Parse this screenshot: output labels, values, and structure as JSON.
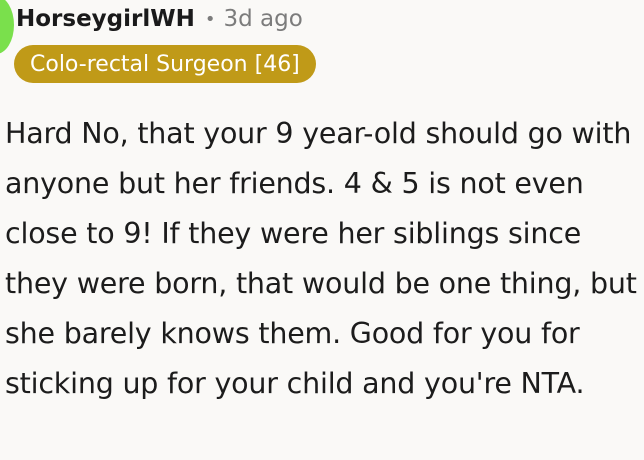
{
  "comment": {
    "author": {
      "username": "HorseygirlWH",
      "flair": "Colo-rectal Surgeon [46]",
      "avatar_color": "#7ae04c"
    },
    "separator": "•",
    "timestamp": "3d ago",
    "body": "Hard No, that your 9 year-old should go with anyone but her friends. 4 & 5 is not even close to 9! If they were her siblings since they were born, that would be one thing, but she barely knows them. Good for you for sticking up for your child and you're NTA."
  },
  "colors": {
    "background": "#faf9f7",
    "flair_background": "#c09a18",
    "meta_text": "#7c7c7c"
  }
}
